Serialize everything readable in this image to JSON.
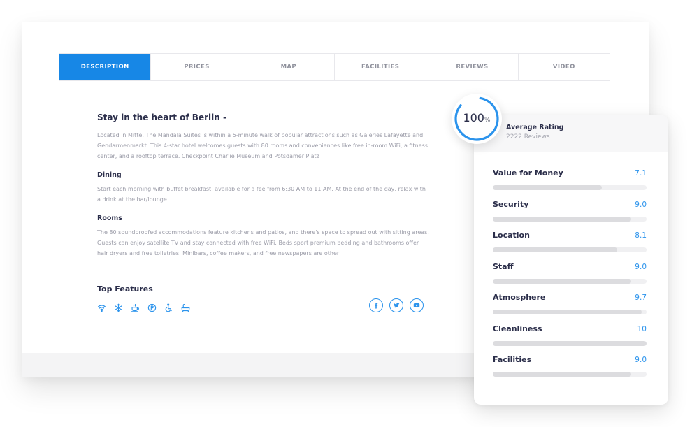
{
  "tabs": [
    {
      "label": "DESCRIPTION",
      "active": true
    },
    {
      "label": "PRICES",
      "active": false
    },
    {
      "label": "MAP",
      "active": false
    },
    {
      "label": "FACILITIES",
      "active": false
    },
    {
      "label": "REVIEWS",
      "active": false
    },
    {
      "label": "VIDEO",
      "active": false
    }
  ],
  "description": {
    "title": "Stay in the heart of Berlin -",
    "intro": "Located in Mitte, The Mandala Suites is within a 5-minute walk of popular attractions such as Galeries Lafayette and Gendarmenmarkt. This 4-star hotel welcomes guests with 80 rooms and conveniences like free in-room WiFi, a fitness center, and a rooftop terrace. Checkpoint Charlie Museum and Potsdamer Platz",
    "dining_title": "Dining",
    "dining_text": "Start each morning with buffet breakfast, available for a fee from 6:30 AM to 11 AM. At the end of the day, relax with a drink at the bar/lounge.",
    "rooms_title": "Rooms",
    "rooms_text": "The 80 soundproofed accommodations feature kitchens and patios, and there's space to spread out with sitting areas. Guests can enjoy satellite TV and stay connected with free WiFi. Beds sport premium bedding and bathrooms offer hair dryers and free toiletries. Minibars, coffee makers, and free newspapers are other"
  },
  "features": {
    "title": "Top Features",
    "icons": [
      "wifi-icon",
      "air-conditioning-icon",
      "coffee-icon",
      "parking-icon",
      "accessible-icon",
      "bathtub-icon"
    ]
  },
  "social": [
    "facebook-icon",
    "twitter-icon",
    "youtube-icon"
  ],
  "rating": {
    "percent_value": "100",
    "percent_sign": "%",
    "percent": 100,
    "title": "Average Rating",
    "reviews": "2222 Reviews",
    "items": [
      {
        "label": "Value for Money",
        "value": "7.1",
        "score": 7.1
      },
      {
        "label": "Security",
        "value": "9.0",
        "score": 9.0
      },
      {
        "label": "Location",
        "value": "8.1",
        "score": 8.1
      },
      {
        "label": "Staff",
        "value": "9.0",
        "score": 9.0
      },
      {
        "label": "Atmosphere",
        "value": "9.7",
        "score": 9.7
      },
      {
        "label": "Cleanliness",
        "value": "10",
        "score": 10
      },
      {
        "label": "Facilities",
        "value": "9.0",
        "score": 9.0
      }
    ],
    "max_score": 10
  },
  "colors": {
    "accent": "#1787e6",
    "link": "#2b93ec",
    "heading": "#2b2e4a",
    "body_text": "#9b9ca8"
  }
}
